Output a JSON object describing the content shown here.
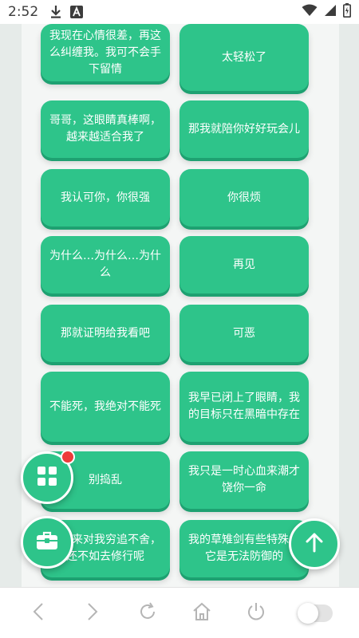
{
  "status_bar": {
    "time": "2:52",
    "icons": [
      "download-icon",
      "a-badge-icon",
      "wifi-icon",
      "signal-icon",
      "battery-icon"
    ]
  },
  "cards": [
    "我现在心情很差，再这么纠缠我。我可不会手下留情",
    "太轻松了",
    "哥哥，这眼睛真棒啊，越来越适合我了",
    "那我就陪你好好玩会儿",
    "我认可你，你很强",
    "你很烦",
    "为什么…为什么…为什么",
    "再见",
    "那就证明给我看吧",
    "可恶",
    "不能死，我绝对不能死",
    "我早已闭上了眼睛，我的目标只在黑暗中存在",
    "别捣乱",
    "我只是一时心血来潮才饶你一命",
    "时间来对我穷追不舍，还不如去修行呢",
    "我的草雉剑有些特殊，它是无法防御的"
  ],
  "fabs": {
    "grid": "grid-icon",
    "toolbox": "toolbox-icon",
    "scroll_top": "arrow-up-icon"
  },
  "nav": [
    "back-icon",
    "forward-icon",
    "refresh-icon",
    "home-icon",
    "power-icon",
    "toggle-switch"
  ],
  "colors": {
    "accent": "#2ec48a",
    "accent_shadow": "#1ea171",
    "badge": "#ee3b3b"
  }
}
